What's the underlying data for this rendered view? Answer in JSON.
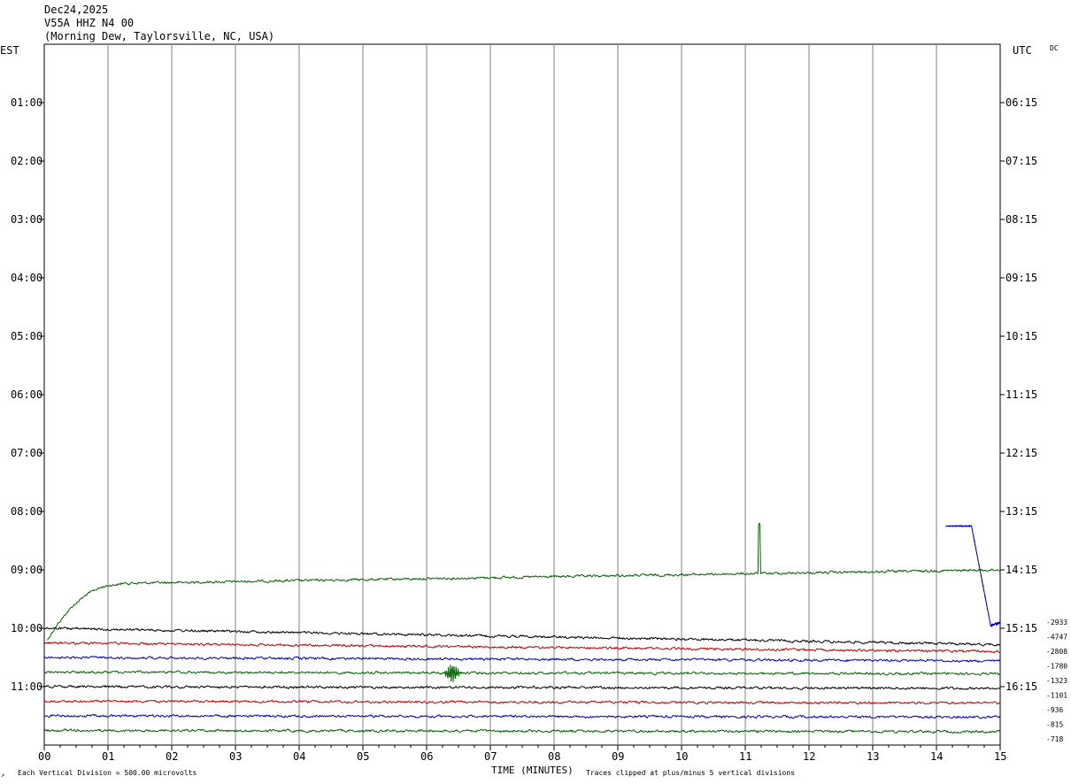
{
  "header": {
    "date": "Dec24,2025",
    "station": "V55A HHZ N4 00",
    "location": "(Morning Dew, Taylorsville, NC, USA)"
  },
  "left_axis_label": "EST",
  "right_axis_label": "UTC",
  "corner_label": "DC",
  "footer": {
    "left_note": "Each Vertical Division =  500.00 microvolts",
    "x_axis_title": "TIME (MINUTES)",
    "right_note": "Traces clipped at plus/minus 5 vertical divisions"
  },
  "chart_data": {
    "type": "line",
    "title": "Dec24,2025 V55A HHZ N4 00",
    "xlabel": "TIME (MINUTES)",
    "ylabel_left": "EST",
    "ylabel_right": "UTC",
    "xlim": [
      0,
      15
    ],
    "x_ticks": [
      "00",
      "01",
      "02",
      "03",
      "04",
      "05",
      "06",
      "07",
      "08",
      "09",
      "10",
      "11",
      "12",
      "13",
      "14",
      "15"
    ],
    "grid_vertical": true,
    "row_span_hours": [
      0,
      12
    ],
    "est_ticks": [
      {
        "hour": 1,
        "label": "01:00"
      },
      {
        "hour": 2,
        "label": "02:00"
      },
      {
        "hour": 3,
        "label": "03:00"
      },
      {
        "hour": 4,
        "label": "04:00"
      },
      {
        "hour": 5,
        "label": "05:00"
      },
      {
        "hour": 6,
        "label": "06:00"
      },
      {
        "hour": 7,
        "label": "07:00"
      },
      {
        "hour": 8,
        "label": "08:00"
      },
      {
        "hour": 9,
        "label": "09:00"
      },
      {
        "hour": 10,
        "label": "10:00"
      },
      {
        "hour": 11,
        "label": "11:00"
      }
    ],
    "utc_ticks": [
      {
        "hour": 1,
        "label": "06:15"
      },
      {
        "hour": 2,
        "label": "07:15"
      },
      {
        "hour": 3,
        "label": "08:15"
      },
      {
        "hour": 4,
        "label": "09:15"
      },
      {
        "hour": 5,
        "label": "10:15"
      },
      {
        "hour": 6,
        "label": "11:15"
      },
      {
        "hour": 7,
        "label": "12:15"
      },
      {
        "hour": 8,
        "label": "13:15"
      },
      {
        "hour": 9,
        "label": "14:15"
      },
      {
        "hour": 10,
        "label": "15:15"
      },
      {
        "hour": 11,
        "label": "16:15"
      }
    ],
    "series": [
      {
        "row_hour": 9.25,
        "color": "#006400",
        "offset": "-2933",
        "start_min": 0.05,
        "end_offset": -0.25,
        "events": [
          {
            "type": "rise",
            "start": 0.05,
            "end": 1.2,
            "depth_hours": -0.95
          },
          {
            "type": "spike",
            "at": 11.22,
            "amplitude_hours": 0.85
          }
        ]
      },
      {
        "row_hour": 9.25,
        "color": "#0000cc",
        "offset": "-4747",
        "start_min": 14.15,
        "end_offset": 0,
        "events": [
          {
            "type": "drop",
            "start": 14.55,
            "end": 14.85,
            "from_hours": 8.25,
            "to_hours": 9.95
          }
        ]
      },
      {
        "row_hour": 10.0,
        "color": "#000000",
        "offset": "-2808",
        "end_offset": 0.28,
        "events": []
      },
      {
        "row_hour": 10.25,
        "color": "#cc0000",
        "offset": "-1780",
        "end_offset": 0.15,
        "events": []
      },
      {
        "row_hour": 10.5,
        "color": "#0000cc",
        "offset": "-1323",
        "end_offset": 0.06,
        "events": []
      },
      {
        "row_hour": 10.75,
        "color": "#006400",
        "offset": "-1101",
        "end_offset": 0.03,
        "events": [
          {
            "type": "burst",
            "at": 6.4,
            "width": 0.3,
            "amplitude_hours": 0.12
          }
        ]
      },
      {
        "row_hour": 11.0,
        "color": "#000000",
        "offset": "-936",
        "end_offset": 0.03,
        "events": []
      },
      {
        "row_hour": 11.25,
        "color": "#cc0000",
        "offset": "-815",
        "end_offset": 0.03,
        "events": []
      },
      {
        "row_hour": 11.5,
        "color": "#0000cc",
        "offset": "-718",
        "end_offset": 0.02,
        "events": []
      },
      {
        "row_hour": 11.75,
        "color": "#006400",
        "offset": "",
        "end_offset": 0.02,
        "events": []
      }
    ]
  }
}
